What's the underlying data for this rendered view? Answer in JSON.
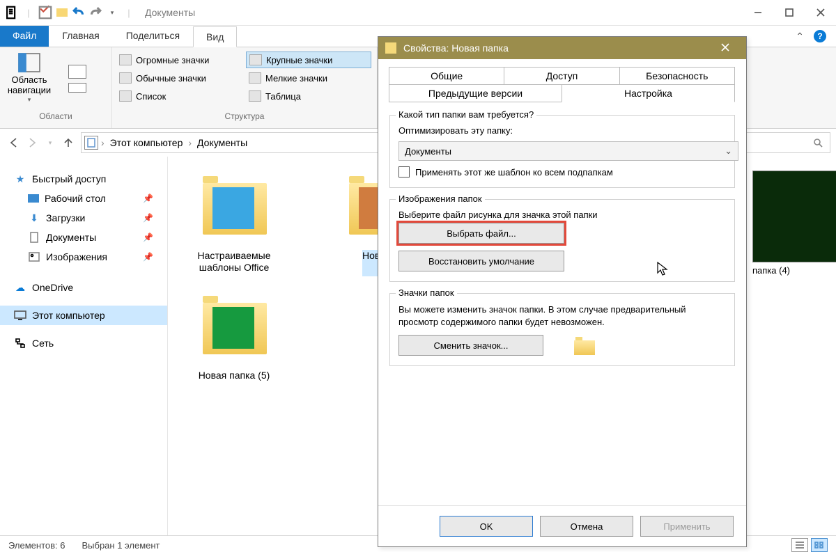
{
  "app": {
    "title": "Документы"
  },
  "tabs": {
    "file": "Файл",
    "home": "Главная",
    "share": "Поделиться",
    "view": "Вид"
  },
  "ribbon": {
    "navpane": "Область навигации",
    "group_panes": "Области",
    "group_layout": "Структура",
    "layout": {
      "huge": "Огромные значки",
      "large": "Крупные значки",
      "normal": "Обычные значки",
      "small": "Мелкие значки",
      "list": "Список",
      "table": "Таблица"
    }
  },
  "breadcrumb": {
    "root": "Этот компьютер",
    "loc": "Документы"
  },
  "tree": {
    "quick": "Быстрый доступ",
    "desktop": "Рабочий стол",
    "downloads": "Загрузки",
    "documents": "Документы",
    "pictures": "Изображения",
    "onedrive": "OneDrive",
    "thispc": "Этот компьютер",
    "network": "Сеть"
  },
  "files": {
    "f1": "Настраиваемые шаблоны Office",
    "f2": "Новая п",
    "f3": "Новая папка (5)",
    "f4": "папка (4)"
  },
  "status": {
    "count": "Элементов: 6",
    "sel": "Выбран 1 элемент"
  },
  "dlg": {
    "title": "Свойства: Новая папка",
    "tabs": {
      "general": "Общие",
      "share": "Доступ",
      "security": "Безопасность",
      "prev": "Предыдущие версии",
      "cust": "Настройка"
    },
    "fs1": {
      "legend": "Какой тип папки вам требуется?",
      "optimize": "Оптимизировать эту папку:",
      "value": "Документы",
      "apply": "Применять этот же шаблон ко всем подпапкам"
    },
    "fs2": {
      "legend": "Изображения папок",
      "hint": "Выберите файл рисунка для значка этой папки",
      "choose": "Выбрать файл...",
      "reset": "Восстановить умолчание"
    },
    "fs3": {
      "legend": "Значки папок",
      "hint": "Вы можете изменить значок папки. В этом случае предварительный просмотр содержимого папки будет невозможен.",
      "change": "Сменить значок..."
    },
    "btns": {
      "ok": "OK",
      "cancel": "Отмена",
      "apply": "Применить"
    }
  }
}
